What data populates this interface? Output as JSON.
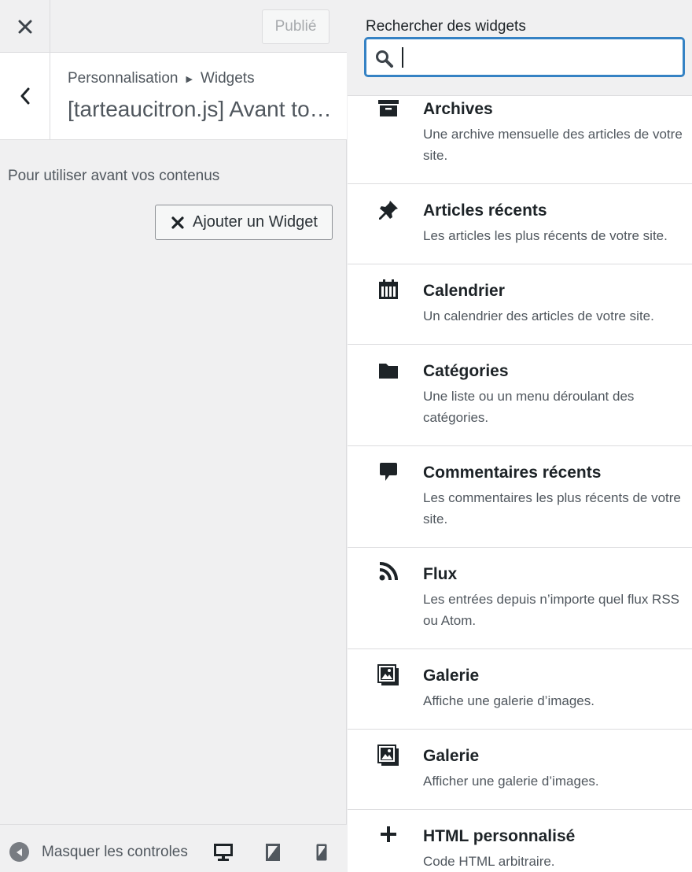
{
  "header": {
    "close_icon": "close-icon",
    "publish_label": "Publié"
  },
  "section": {
    "breadcrumb_root": "Personnalisation",
    "breadcrumb_current": "Widgets",
    "title": "[tarteaucitron.js] Avant to…",
    "description": "Pour utiliser avant vos contenus",
    "add_widget_label": "Ajouter un Widget"
  },
  "footer": {
    "collapse_label": "Masquer les controles",
    "devices": [
      "desktop-icon",
      "tablet-icon",
      "mobile-icon"
    ]
  },
  "picker": {
    "search_label": "Rechercher des widgets",
    "search_value": "",
    "search_placeholder": ""
  },
  "widgets": [
    {
      "icon": "archive-icon",
      "name": "Archives",
      "desc": "Une archive mensuelle des articles de votre site."
    },
    {
      "icon": "pin-icon",
      "name": "Articles récents",
      "desc": "Les articles les plus récents de votre site."
    },
    {
      "icon": "calendar-icon",
      "name": "Calendrier",
      "desc": "Un calendrier des articles de votre site."
    },
    {
      "icon": "folder-icon",
      "name": "Catégories",
      "desc": "Une liste ou un menu déroulant des catégories."
    },
    {
      "icon": "comment-icon",
      "name": "Commentaires récents",
      "desc": "Les commentaires les plus récents de votre site."
    },
    {
      "icon": "rss-icon",
      "name": "Flux",
      "desc": "Les entrées depuis n’importe quel flux RSS ou Atom."
    },
    {
      "icon": "gallery-icon",
      "name": "Galerie",
      "desc": "Affiche une galerie d’images."
    },
    {
      "icon": "gallery-icon",
      "name": "Galerie",
      "desc": "Afficher une galerie d’images."
    },
    {
      "icon": "plus-icon",
      "name": "HTML personnalisé",
      "desc": "Code HTML arbitraire."
    }
  ]
}
